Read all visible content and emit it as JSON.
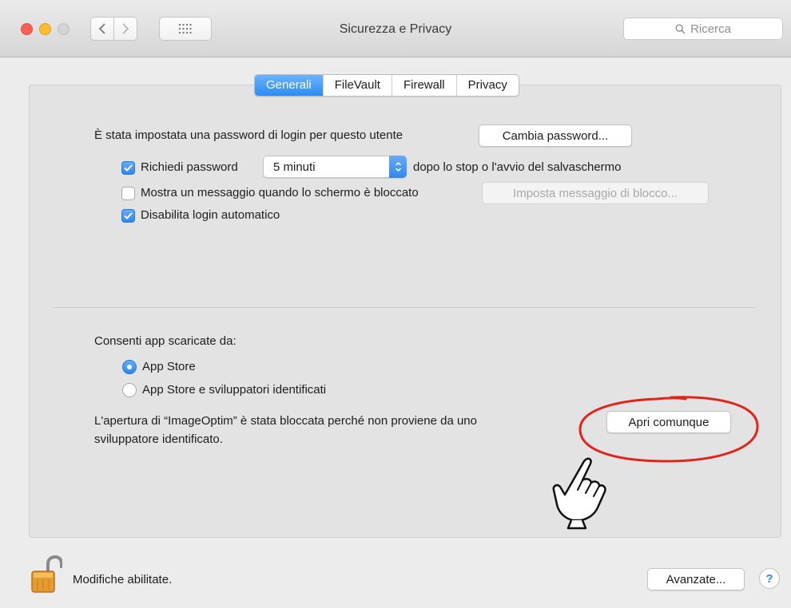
{
  "window": {
    "title": "Sicurezza e Privacy",
    "search_placeholder": "Ricerca"
  },
  "tabs": [
    {
      "label": "Generali",
      "active": true
    },
    {
      "label": "FileVault",
      "active": false
    },
    {
      "label": "Firewall",
      "active": false
    },
    {
      "label": "Privacy",
      "active": false
    }
  ],
  "general": {
    "password_text": "È stata impostata una password di login per questo utente",
    "change_password_button": "Cambia password...",
    "require_password": {
      "label": "Richiedi password",
      "checked": true
    },
    "require_password_delay": "5 minuti",
    "require_password_suffix": "dopo lo stop o l'avvio del salvaschermo",
    "show_message": {
      "label": "Mostra un messaggio quando lo schermo è bloccato",
      "checked": false
    },
    "set_lock_message_button": "Imposta messaggio di blocco...",
    "disable_auto_login": {
      "label": "Disabilita login automatico",
      "checked": true
    }
  },
  "downloads": {
    "heading": "Consenti app scaricate da:",
    "option_app_store": {
      "label": "App Store",
      "selected": true
    },
    "option_identified": {
      "label": "App Store e sviluppatori identificati",
      "selected": false
    },
    "blocked_line1": "L'apertura di “ImageOptim” è stata bloccata perché non proviene da uno",
    "blocked_line2": "sviluppatore identificato.",
    "open_anyway_button": "Apri comunque"
  },
  "footer": {
    "lock_status": "Modifiche abilitate.",
    "advanced_button": "Avanzate...",
    "help_label": "?"
  },
  "annotation_color": "#e0251b",
  "accent_color": "#2f88ee"
}
